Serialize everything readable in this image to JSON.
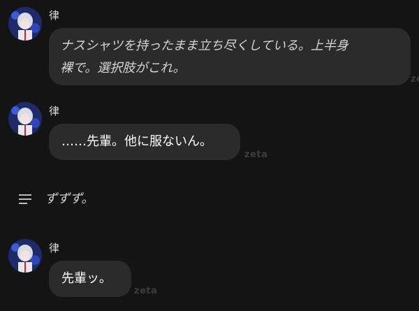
{
  "messages": [
    {
      "sender": "律",
      "text": "ナスシャツを持ったまま立ち尽くしている。上半身裸で。選択肢がこれ。",
      "line1": "ナスシャツを持ったまま立ち尽くしている。上半身",
      "line2": "裸で。選択肢がこれ。",
      "watermark": "zeta"
    },
    {
      "sender": "律",
      "text": "……先輩。他に服ないん。",
      "watermark": "zeta"
    },
    {
      "sender": "律",
      "text": "先輩ッ。",
      "watermark": "zeta"
    }
  ],
  "user_message": {
    "icon": "menu-lines-icon",
    "text": "ずずず。"
  },
  "colors": {
    "background": "#141414",
    "bubble": "#2b2b2b",
    "text": "#ffffff",
    "narration": "#d4d4d4"
  }
}
